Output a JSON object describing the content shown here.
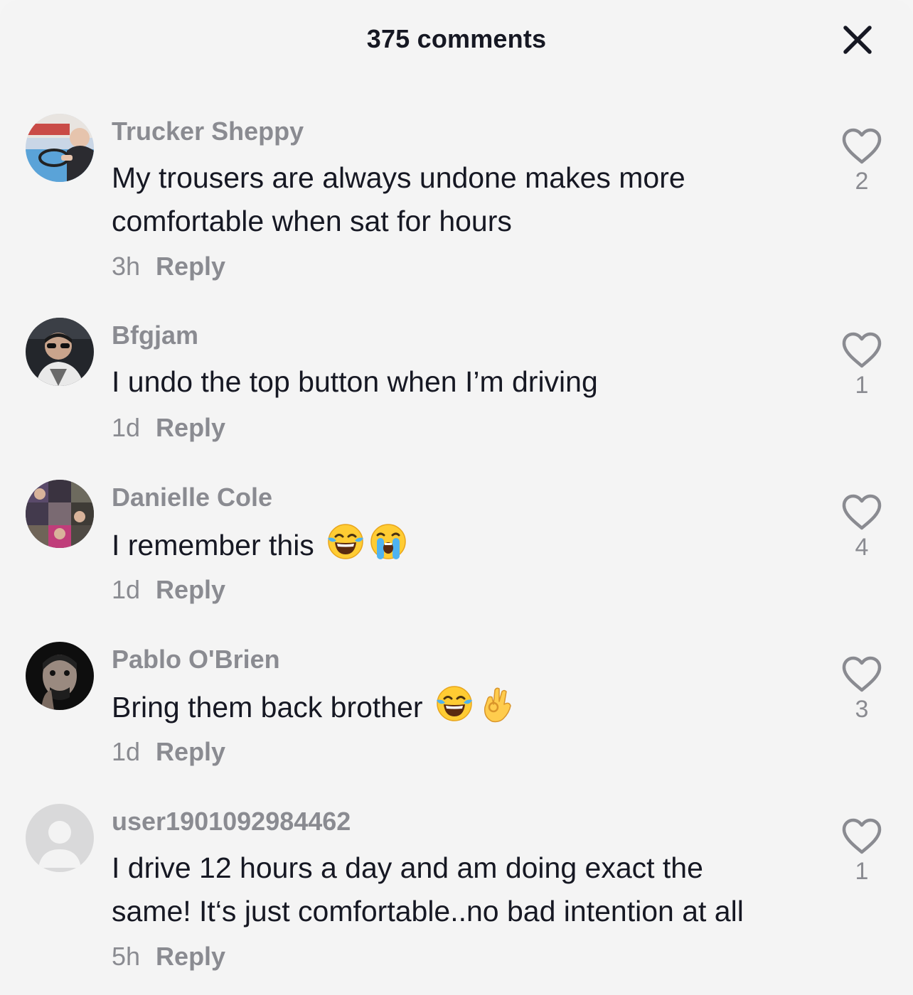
{
  "header": {
    "title": "375 comments"
  },
  "comments": [
    {
      "username": "Trucker Sheppy",
      "text_lines": [
        "My trousers are always undone makes more",
        "comfortable when sat for hours"
      ],
      "time": "3h",
      "reply_label": "Reply",
      "likes": "2"
    },
    {
      "username": "Bfgjam",
      "text_lines": [
        "I undo the top button when I’m driving"
      ],
      "time": "1d",
      "reply_label": "Reply",
      "likes": "1"
    },
    {
      "username": "Danielle Cole",
      "text_lines": [
        "I remember this"
      ],
      "emojis": [
        "tears-of-joy",
        "loudly-crying"
      ],
      "time": "1d",
      "reply_label": "Reply",
      "likes": "4"
    },
    {
      "username": "Pablo O'Brien",
      "text_lines": [
        "Bring them back brother"
      ],
      "emojis": [
        "tears-of-joy",
        "ok-hand"
      ],
      "time": "1d",
      "reply_label": "Reply",
      "likes": "3"
    },
    {
      "username": "user1901092984462",
      "text_lines": [
        "I drive 12 hours a day and am doing exact the",
        "same! It‘s just comfortable..no bad intention at all"
      ],
      "time": "5h",
      "reply_label": "Reply",
      "likes": "1"
    }
  ],
  "icons": {
    "close": "close-icon",
    "like": "heart-outline-icon"
  },
  "colors": {
    "background": "#f4f4f4",
    "text_primary": "#161823",
    "text_secondary": "#8a8b91"
  }
}
